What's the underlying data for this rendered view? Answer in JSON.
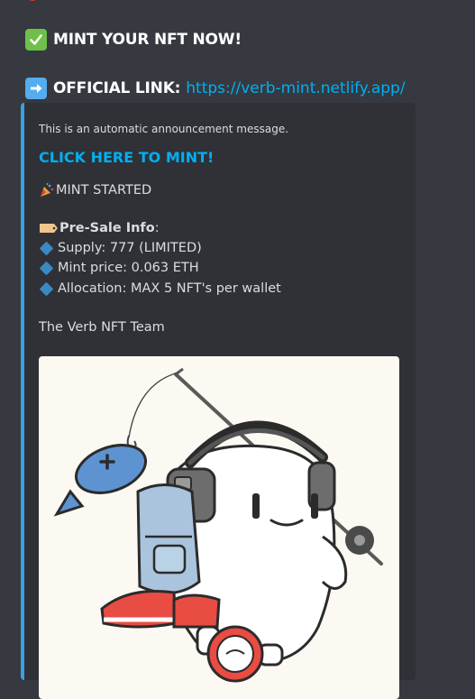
{
  "mint_line": {
    "text": "MINT YOUR NFT NOW!"
  },
  "official_line": {
    "label": "OFFICIAL LINK:",
    "url": "https://verb-mint.netlify.app/"
  },
  "embed": {
    "intro": "This is an automatic announcement message.",
    "cta": "CLICK HERE TO MINT!",
    "mint_started": "MINT STARTED",
    "presale_title": "Pre-Sale Info",
    "presale_colon": ":",
    "supply": "Supply: 777 (LIMITED)",
    "mint_price": "Mint price: 0.063 ETH",
    "allocation": "Allocation: MAX 5 NFT's per wallet",
    "signature": "The Verb NFT Team"
  },
  "colors": {
    "background": "#36393f",
    "embed_bg": "#2f3136",
    "embed_accent": "#3ba0e0",
    "link": "#00aff4"
  },
  "icons": [
    "check-mark-icon",
    "arrow-right-icon",
    "party-popper-icon",
    "label-tag-icon",
    "blue-diamond-icon"
  ]
}
